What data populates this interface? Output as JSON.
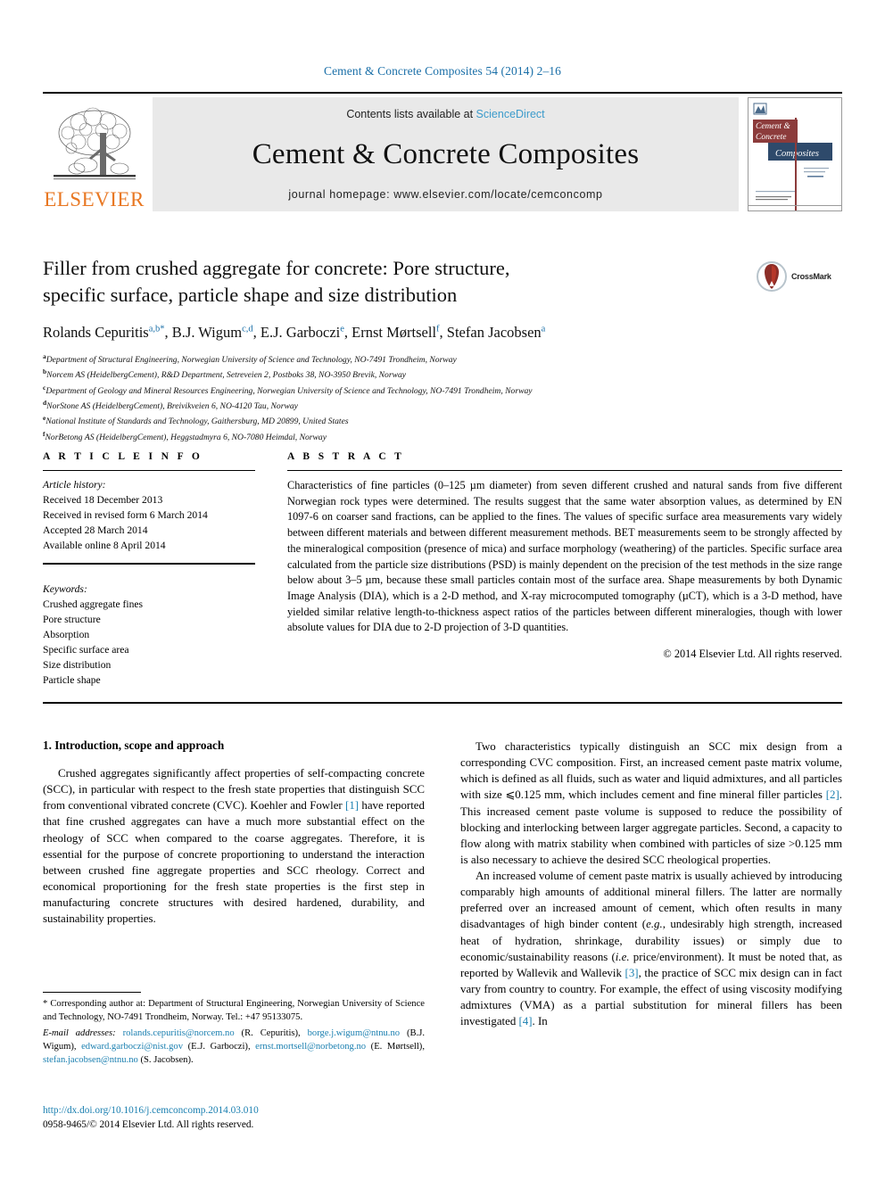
{
  "running_head": "Cement & Concrete Composites 54 (2014) 2–16",
  "masthead": {
    "publisher_name": "ELSEVIER",
    "contents_prefix": "Contents lists available at ",
    "contents_link": "ScienceDirect",
    "journal_title": "Cement & Concrete Composites",
    "homepage": "journal homepage: www.elsevier.com/locate/cemconcomp",
    "cover": {
      "line1": "Cement &",
      "line2": "Concrete",
      "line3": "Composites"
    }
  },
  "article": {
    "title_line1": "Filler from crushed aggregate for concrete: Pore structure,",
    "title_line2": "specific surface, particle shape and size distribution",
    "crossmark_label": "CrossMark",
    "authors": [
      {
        "name": "Rolands Cepuritis",
        "sup": "a,b",
        "star": "*",
        "sep": ", "
      },
      {
        "name": "B.J. Wigum",
        "sup": "c,d",
        "star": "",
        "sep": ", "
      },
      {
        "name": "E.J. Garboczi",
        "sup": "e",
        "star": "",
        "sep": ", "
      },
      {
        "name": "Ernst Mørtsell",
        "sup": "f",
        "star": "",
        "sep": ", "
      },
      {
        "name": "Stefan Jacobsen",
        "sup": "a",
        "star": "",
        "sep": ""
      }
    ],
    "affiliations": [
      {
        "mark": "a",
        "text": "Department of Structural Engineering, Norwegian University of Science and Technology, NO-7491 Trondheim, Norway"
      },
      {
        "mark": "b",
        "text": "Norcem AS (HeidelbergCement), R&D Department, Setreveien 2, Postboks 38, NO-3950 Brevik, Norway"
      },
      {
        "mark": "c",
        "text": "Department of Geology and Mineral Resources Engineering, Norwegian University of Science and Technology, NO-7491 Trondheim, Norway"
      },
      {
        "mark": "d",
        "text": "NorStone AS (HeidelbergCement), Breivikveien 6, NO-4120 Tau, Norway"
      },
      {
        "mark": "e",
        "text": "National Institute of Standards and Technology, Gaithersburg, MD 20899, United States"
      },
      {
        "mark": "f",
        "text": "NorBetong AS (HeidelbergCement), Heggstadmyra 6, NO-7080 Heimdal, Norway"
      }
    ]
  },
  "article_info": {
    "label": "A R T I C L E   I N F O",
    "history_heading": "Article history:",
    "history": [
      "Received 18 December 2013",
      "Received in revised form 6 March 2014",
      "Accepted 28 March 2014",
      "Available online 8 April 2014"
    ],
    "keywords_heading": "Keywords:",
    "keywords": [
      "Crushed aggregate fines",
      "Pore structure",
      "Absorption",
      "Specific surface area",
      "Size distribution",
      "Particle shape"
    ]
  },
  "abstract": {
    "label": "A B S T R A C T",
    "text": "Characteristics of fine particles (0–125 µm diameter) from seven different crushed and natural sands from five different Norwegian rock types were determined. The results suggest that the same water absorption values, as determined by EN 1097-6 on coarser sand fractions, can be applied to the fines. The values of specific surface area measurements vary widely between different materials and between different measurement methods. BET measurements seem to be strongly affected by the mineralogical composition (presence of mica) and surface morphology (weathering) of the particles. Specific surface area calculated from the particle size distributions (PSD) is mainly dependent on the precision of the test methods in the size range below about 3–5 µm, because these small particles contain most of the surface area. Shape measurements by both Dynamic Image Analysis (DIA), which is a 2-D method, and X-ray microcomputed tomography (µCT), which is a 3-D method, have yielded similar relative length-to-thickness aspect ratios of the particles between different mineralogies, though with lower absolute values for DIA due to 2-D projection of 3-D quantities.",
    "copyright": "© 2014 Elsevier Ltd. All rights reserved."
  },
  "body": {
    "section_heading": "1. Introduction, scope and approach",
    "left_paragraphs": [
      {
        "parts": [
          {
            "t": "Crushed aggregates significantly affect properties of self-compacting concrete (SCC), in particular with respect to the fresh state properties that distinguish SCC from conventional vibrated concrete (CVC). Koehler and Fowler "
          },
          {
            "t": "[1]",
            "ref": true
          },
          {
            "t": " have reported that fine crushed aggregates can have a much more substantial effect on the rheology of SCC when compared to the coarse aggregates. Therefore, it is essential for the purpose of concrete proportioning to understand the interaction between crushed fine aggregate properties and SCC rheology. Correct and economical proportioning for the fresh state properties is the first step in manufacturing concrete structures with desired hardened, durability, and sustainability properties."
          }
        ]
      }
    ],
    "right_paragraphs": [
      {
        "parts": [
          {
            "t": "Two characteristics typically distinguish an SCC mix design from a corresponding CVC composition. First, an increased cement paste matrix volume, which is defined as all fluids, such as water and liquid admixtures, and all particles with size ⩽0.125 mm, which includes cement and fine mineral filler particles "
          },
          {
            "t": "[2]",
            "ref": true
          },
          {
            "t": ". This increased cement paste volume is supposed to reduce the possibility of blocking and interlocking between larger aggregate particles. Second, a capacity to flow along with matrix stability when combined with particles of size >0.125 mm is also necessary to achieve the desired SCC rheological properties."
          }
        ]
      },
      {
        "parts": [
          {
            "t": "An increased volume of cement paste matrix is usually achieved by introducing comparably high amounts of additional mineral fillers. The latter are normally preferred over an increased amount of cement, which often results in many disadvantages of high binder content ("
          },
          {
            "t": "e.g.",
            "italic": true
          },
          {
            "t": ", undesirably high strength, increased heat of hydration, shrinkage, durability issues) or simply due to economic/sustainability reasons ("
          },
          {
            "t": "i.e.",
            "italic": true
          },
          {
            "t": " price/environment). It must be noted that, as reported by Wallevik and Wallevik "
          },
          {
            "t": "[3]",
            "ref": true
          },
          {
            "t": ", the practice of SCC mix design can in fact vary from country to country. For example, the effect of using viscosity modifying admixtures (VMA) as a partial substitution for mineral fillers has been investigated "
          },
          {
            "t": "[4]",
            "ref": true
          },
          {
            "t": ". In"
          }
        ]
      }
    ]
  },
  "footnote": {
    "corresponding": "* Corresponding author at: Department of Structural Engineering, Norwegian University of Science and Technology, NO-7491 Trondheim, Norway. Tel.: +47 95133075.",
    "email_heading": "E-mail addresses:",
    "emails": [
      {
        "addr": "rolands.cepuritis@norcem.no",
        "who": " (R. Cepuritis), "
      },
      {
        "addr": "borge.j.wigum@ntnu.no",
        "who": " (B.J. Wigum), "
      },
      {
        "addr": "edward.garboczi@nist.gov",
        "who": " (E.J. Garboczi), "
      },
      {
        "addr": "ernst.mortsell@norbetong.no",
        "who": " (E. Mørtsell), "
      },
      {
        "addr": "stefan.jacobsen@ntnu.no",
        "who": " (S. Jacobsen)."
      }
    ],
    "doi": "http://dx.doi.org/10.1016/j.cemconcomp.2014.03.010",
    "issn_line": "0958-9465/© 2014 Elsevier Ltd. All rights reserved."
  },
  "colors": {
    "link_blue": "#1a7fb0",
    "sciencedirect_blue": "#3C9BCB",
    "elsevier_orange": "#E87722",
    "cover_maroon": "#8C3B3B",
    "cover_navy": "#2E4A6B",
    "band_gray": "#e9e9e9"
  }
}
